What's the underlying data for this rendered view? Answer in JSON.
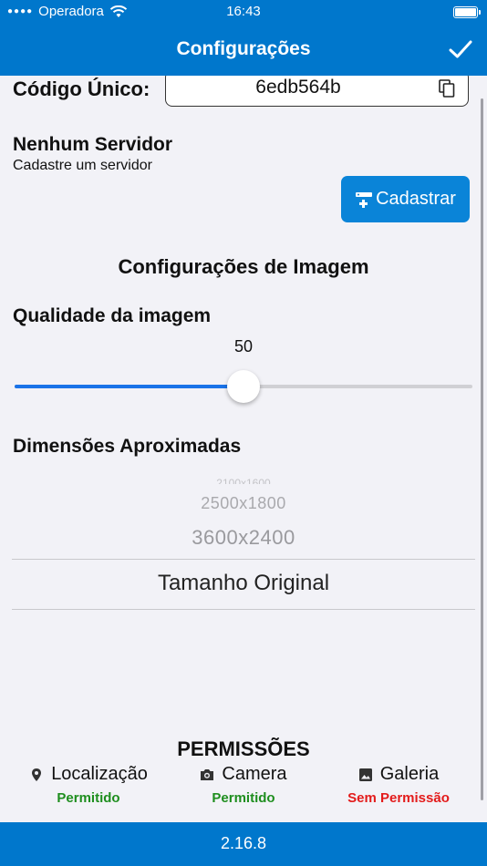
{
  "status_bar": {
    "carrier": "Operadora",
    "time": "16:43"
  },
  "nav": {
    "title": "Configurações"
  },
  "unique_code": {
    "label": "Código Único:",
    "value": "6edb564b"
  },
  "server": {
    "title": "Nenhum Servidor",
    "subtitle": "Cadastre um servidor",
    "register_label": "Cadastrar"
  },
  "image_settings": {
    "title": "Configurações de Imagem",
    "quality_label": "Qualidade da imagem",
    "quality_value": "50",
    "quality_min": 0,
    "quality_max": 100,
    "dimensions_label": "Dimensões Aproximadas",
    "dimension_options": [
      "2100x1600",
      "2500x1800",
      "3600x2400"
    ],
    "selected_dimension": "Tamanho Original"
  },
  "permissions": {
    "title": "PERMISSÕES",
    "items": [
      {
        "label": "Localização",
        "status": "Permitido",
        "icon": "location-pin-icon",
        "status_color": "#1e8e1e"
      },
      {
        "label": "Camera",
        "status": "Permitido",
        "icon": "camera-icon",
        "status_color": "#1e8e1e"
      },
      {
        "label": "Galeria",
        "status": "Sem Permissão",
        "icon": "image-icon",
        "status_color": "#e31b1b"
      }
    ]
  },
  "footer": {
    "version": "2.16.8"
  },
  "colors": {
    "primary": "#0077cc",
    "button": "#0a84d8",
    "slider": "#1a73e8"
  }
}
